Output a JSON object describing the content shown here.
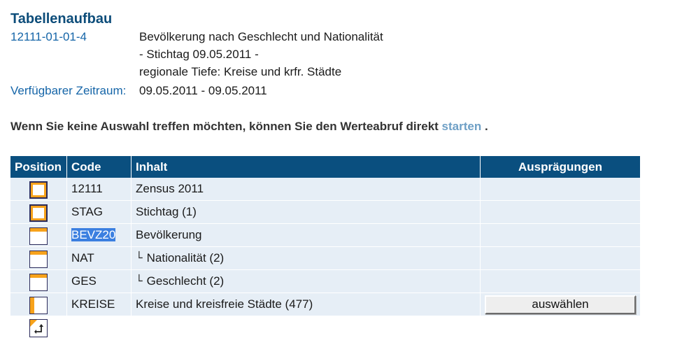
{
  "page": {
    "title": "Tabellenaufbau"
  },
  "table_info": {
    "code": "12111-01-01-4",
    "description_lines": [
      "Bevölkerung nach Geschlecht und Nationalität",
      "- Stichtag 09.05.2011 -",
      "regionale Tiefe: Kreise und krfr. Städte"
    ],
    "period_label": "Verfügbarer Zeitraum:",
    "period_value": "09.05.2011 - 09.05.2011"
  },
  "intro": {
    "text": "Wenn Sie keine Auswahl treffen möchten, können Sie den Werteabruf direkt",
    "link_label": "starten",
    "suffix": "."
  },
  "grid": {
    "headers": {
      "position": "Position",
      "code": "Code",
      "inhalt": "Inhalt",
      "auspraegungen": "Ausprägungen"
    },
    "rows": [
      {
        "position_icon": "position-box-icon",
        "code": "12111",
        "inhalt": "Zensus 2011",
        "indent": 0
      },
      {
        "position_icon": "position-box-icon",
        "code": "STAG",
        "inhalt": "Stichtag (1)",
        "indent": 0
      },
      {
        "position_icon": "position-header-icon",
        "code": "BEVZ20",
        "inhalt": "Bevölkerung",
        "indent": 0,
        "selected": true
      },
      {
        "position_icon": "position-header-icon",
        "code": "NAT",
        "inhalt": "Nationalität (2)",
        "indent": 1
      },
      {
        "position_icon": "position-header-icon",
        "code": "GES",
        "inhalt": "Geschlecht (2)",
        "indent": 2
      },
      {
        "position_icon": "position-side-icon",
        "code": "KREISE",
        "inhalt": "Kreise und kreisfreie Städte (477)",
        "indent": 0,
        "button": "auswählen"
      }
    ],
    "tree_glyph": "└"
  },
  "colors": {
    "header_bg": "#0a4f7f",
    "row_bg": "#e6eef6",
    "accent_orange": "#f7a21b",
    "icon_border": "#2a2a5a",
    "link": "#6fa0c6",
    "title": "#0d4d7a"
  },
  "icons": {
    "swap": "swap-icon"
  }
}
